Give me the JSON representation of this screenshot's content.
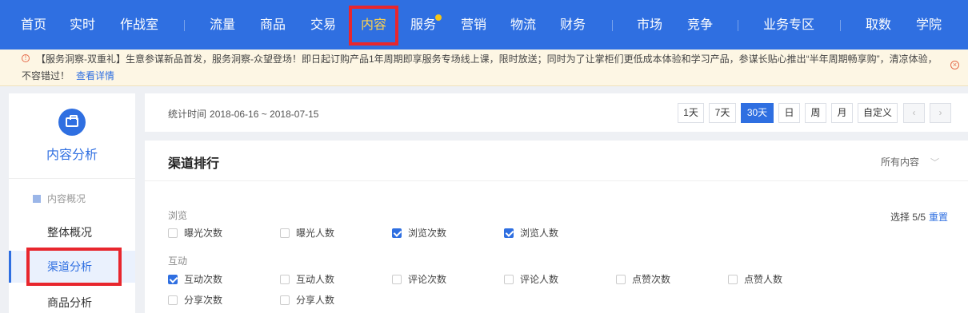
{
  "nav": {
    "items": [
      "首页",
      "实时",
      "作战室",
      "流量",
      "商品",
      "交易",
      "内容",
      "服务",
      "营销",
      "物流",
      "财务",
      "市场",
      "竞争",
      "业务专区",
      "取数",
      "学院"
    ],
    "active": "内容"
  },
  "notice": {
    "text": "【服务洞察-双重礼】生意参谋新品首发，服务洞察-众望登场！即日起订购产品1年周期即享服务专场线上课，限时放送；同时为了让掌柜们更低成本体验和学习产品，参谋长贴心推出“半年周期畅享购”，清凉体验，不容错过！",
    "link": "查看详情"
  },
  "sidebar": {
    "title": "内容分析",
    "group": "内容概况",
    "items": [
      "整体概况",
      "渠道分析",
      "商品分析"
    ],
    "active": "渠道分析"
  },
  "datebar": {
    "label": "统计时间",
    "range": "2018-06-16 ~ 2018-07-15",
    "buttons": [
      "1天",
      "7天",
      "30天",
      "日",
      "周",
      "月",
      "自定义"
    ],
    "active": "30天",
    "prev": "‹",
    "next": "›"
  },
  "panel": {
    "title": "渠道排行",
    "filter": "所有内容",
    "select_count": "选择 5/5",
    "reset": "重置",
    "groups": [
      {
        "label": "浏览",
        "options": [
          {
            "label": "曝光次数",
            "checked": false
          },
          {
            "label": "曝光人数",
            "checked": false
          },
          {
            "label": "浏览次数",
            "checked": true
          },
          {
            "label": "浏览人数",
            "checked": true
          }
        ]
      },
      {
        "label": "互动",
        "options": [
          {
            "label": "互动次数",
            "checked": true
          },
          {
            "label": "互动人数",
            "checked": false
          },
          {
            "label": "评论次数",
            "checked": false
          },
          {
            "label": "评论人数",
            "checked": false
          },
          {
            "label": "点赞次数",
            "checked": false
          },
          {
            "label": "点赞人数",
            "checked": false
          },
          {
            "label": "分享次数",
            "checked": false
          },
          {
            "label": "分享人数",
            "checked": false
          }
        ]
      }
    ]
  },
  "colors": {
    "primary": "#2f6fe1",
    "highlight": "#e8262d",
    "active_nav": "#ffd34d"
  }
}
